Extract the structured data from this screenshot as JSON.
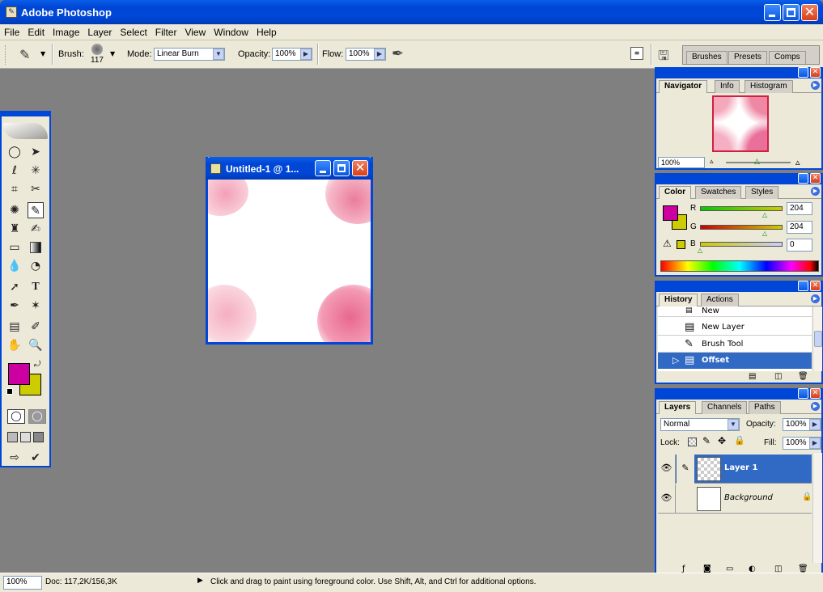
{
  "window": {
    "title": "Adobe Photoshop"
  },
  "menu": [
    "File",
    "Edit",
    "Image",
    "Layer",
    "Select",
    "Filter",
    "View",
    "Window",
    "Help"
  ],
  "options": {
    "brush_label": "Brush:",
    "brush_size": "117",
    "mode_label": "Mode:",
    "mode_value": "Linear Burn",
    "opacity_label": "Opacity:",
    "opacity_value": "100%",
    "flow_label": "Flow:",
    "flow_value": "100%",
    "well_tabs": [
      "Brushes",
      "Presets",
      "Comps"
    ]
  },
  "document": {
    "title": "Untitled-1 @ 1..."
  },
  "navigator": {
    "tabs": [
      "Navigator",
      "Info",
      "Histogram"
    ],
    "zoom": "100%"
  },
  "color": {
    "tabs": [
      "Color",
      "Swatches",
      "Styles"
    ],
    "r_label": "R",
    "r_value": "204",
    "g_label": "G",
    "g_value": "204",
    "b_label": "B",
    "b_value": "0",
    "foreground": "#cc00a0",
    "background": "#cccc00"
  },
  "history": {
    "tabs": [
      "History",
      "Actions"
    ],
    "items": [
      "New",
      "New Layer",
      "Brush Tool",
      "Offset"
    ]
  },
  "layers": {
    "tabs": [
      "Layers",
      "Channels",
      "Paths"
    ],
    "blend_mode": "Normal",
    "opacity_label": "Opacity:",
    "opacity_value": "100%",
    "lock_label": "Lock:",
    "fill_label": "Fill:",
    "fill_value": "100%",
    "items": [
      "Layer 1",
      "Background"
    ]
  },
  "status": {
    "zoom": "100%",
    "doc": "Doc: 117,2K/156,3K",
    "hint": "Click and drag to paint using foreground color.  Use Shift, Alt, and Ctrl for additional options."
  }
}
